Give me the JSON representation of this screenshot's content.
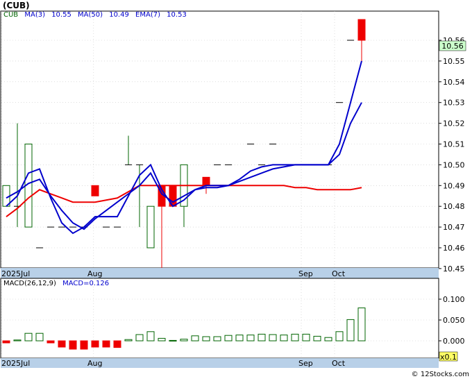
{
  "title": "(CUB)",
  "credit": "© 12Stocks.com",
  "colors": {
    "frame": "#000000",
    "grid": "#c8c8c8",
    "axis_band": "#b8d0e8",
    "ma3": "#0000cc",
    "ma50": "#ee0000",
    "ema7": "#0000cc",
    "up": "#006400",
    "down": "#ee0000",
    "price_badge_bg": "#ccffcc",
    "macd_bar": "#006400",
    "macd_neg": "#ee0000",
    "scale_badge_bg": "#ffff66"
  },
  "price_panel": {
    "legend": {
      "symbol": "CUB",
      "ma3_label": "MA(3)",
      "ma3_value": "10.55",
      "ma50_label": "MA(50)",
      "ma50_value": "10.49",
      "ema7_label": "EMA(7)",
      "ema7_value": "10.53"
    },
    "last_price": "10.56",
    "y_ticks": [
      "10.56",
      "10.55",
      "10.54",
      "10.53",
      "10.52",
      "10.51",
      "10.50",
      "10.49",
      "10.48",
      "10.47",
      "10.46",
      "10.45"
    ],
    "x_labels": [
      "2025Jul",
      "Aug",
      "Sep",
      "Oct"
    ]
  },
  "macd_panel": {
    "legend_label": "MACD(26,12,9)",
    "legend_value_label": "MACD=0.126",
    "y_ticks": [
      "0.100",
      "0.050",
      "0.000"
    ],
    "x_labels": [
      "2025Jul",
      "Aug",
      "Sep",
      "Oct"
    ],
    "scale_badge": "x0.1"
  },
  "chart_data": [
    {
      "type": "candlestick",
      "title": "(CUB)",
      "y_range": [
        10.445,
        10.575
      ],
      "grid": true,
      "candles": [
        {
          "open": 10.48,
          "high": 10.49,
          "low": 10.48,
          "close": 10.49
        },
        {
          "open": 10.48,
          "high": 10.52,
          "low": 10.47,
          "close": 10.48
        },
        {
          "open": 10.47,
          "high": 10.51,
          "low": 10.47,
          "close": 10.51
        },
        {
          "open": 10.46,
          "high": 10.46,
          "low": 10.46,
          "close": 10.46
        },
        {
          "open": 10.47,
          "high": 10.47,
          "low": 10.47,
          "close": 10.47
        },
        {
          "open": 10.47,
          "high": 10.47,
          "low": 10.47,
          "close": 10.47
        },
        {
          "open": 10.47,
          "high": 10.47,
          "low": 10.47,
          "close": 10.47
        },
        {
          "open": 10.47,
          "high": 10.47,
          "low": 10.47,
          "close": 10.47
        },
        {
          "open": 10.49,
          "high": 10.49,
          "low": 10.485,
          "close": 10.485
        },
        {
          "open": 10.47,
          "high": 10.47,
          "low": 10.47,
          "close": 10.47
        },
        {
          "open": 10.47,
          "high": 10.47,
          "low": 10.47,
          "close": 10.47
        },
        {
          "open": 10.5,
          "high": 10.514,
          "low": 10.5,
          "close": 10.5
        },
        {
          "open": 10.5,
          "high": 10.5,
          "low": 10.47,
          "close": 10.5
        },
        {
          "open": 10.46,
          "high": 10.48,
          "low": 10.46,
          "close": 10.48
        },
        {
          "open": 10.49,
          "high": 10.49,
          "low": 10.45,
          "close": 10.48
        },
        {
          "open": 10.49,
          "high": 10.49,
          "low": 10.48,
          "close": 10.48
        },
        {
          "open": 10.48,
          "high": 10.49,
          "low": 10.47,
          "close": 10.5
        },
        {
          "open": 10.49,
          "high": 10.49,
          "low": 10.49,
          "close": 10.49
        },
        {
          "open": 10.494,
          "high": 10.494,
          "low": 10.486,
          "close": 10.49
        },
        {
          "open": 10.5,
          "high": 10.5,
          "low": 10.5,
          "close": 10.5
        },
        {
          "open": 10.5,
          "high": 10.5,
          "low": 10.5,
          "close": 10.5
        },
        {
          "open": 10.49,
          "high": 10.49,
          "low": 10.49,
          "close": 10.49
        },
        {
          "open": 10.51,
          "high": 10.51,
          "low": 10.51,
          "close": 10.51
        },
        {
          "open": 10.5,
          "high": 10.5,
          "low": 10.5,
          "close": 10.5
        },
        {
          "open": 10.51,
          "high": 10.51,
          "low": 10.51,
          "close": 10.51
        },
        {
          "open": 10.5,
          "high": 10.5,
          "low": 10.5,
          "close": 10.5
        },
        {
          "open": 10.5,
          "high": 10.5,
          "low": 10.5,
          "close": 10.5
        },
        {
          "open": 10.5,
          "high": 10.5,
          "low": 10.5,
          "close": 10.5
        },
        {
          "open": 10.5,
          "high": 10.5,
          "low": 10.5,
          "close": 10.5
        },
        {
          "open": 10.5,
          "high": 10.5,
          "low": 10.5,
          "close": 10.5
        },
        {
          "open": 10.53,
          "high": 10.53,
          "low": 10.53,
          "close": 10.53
        },
        {
          "open": 10.56,
          "high": 10.56,
          "low": 10.56,
          "close": 10.56
        },
        {
          "open": 10.57,
          "high": 10.57,
          "low": 10.55,
          "close": 10.56
        }
      ],
      "series": [
        {
          "name": "MA(3)",
          "values": [
            10.48,
            10.485,
            10.496,
            10.498,
            10.484,
            10.472,
            10.467,
            10.47,
            10.475,
            10.475,
            10.475,
            10.485,
            10.495,
            10.5,
            10.488,
            10.48,
            10.483,
            10.488,
            10.49,
            10.49,
            10.49,
            10.493,
            10.497,
            10.499,
            10.5,
            10.5,
            10.5,
            10.5,
            10.5,
            10.5,
            10.51,
            10.53,
            10.55
          ]
        },
        {
          "name": "MA(50)",
          "values": [
            null,
            null,
            null,
            null,
            null,
            null,
            null,
            null,
            null,
            null,
            null,
            null,
            null,
            null,
            null,
            null,
            null,
            null,
            null,
            null,
            null,
            null,
            null,
            null,
            null,
            null,
            null,
            null,
            null,
            null,
            null,
            null,
            null
          ]
        },
        {
          "name": "EMA(7)",
          "values": [
            10.484,
            10.487,
            10.491,
            10.493,
            10.485,
            10.478,
            10.472,
            10.469,
            10.474,
            10.478,
            10.482,
            10.486,
            10.49,
            10.496,
            10.486,
            10.482,
            10.485,
            10.488,
            10.489,
            10.489,
            10.49,
            10.492,
            10.494,
            10.496,
            10.498,
            10.499,
            10.5,
            10.5,
            10.5,
            10.5,
            10.505,
            10.52,
            10.53
          ]
        }
      ]
    },
    {
      "type": "bar",
      "title": "MACD(26,12,9)",
      "y_range": [
        -0.02,
        0.14
      ],
      "grid": true,
      "values": [
        -0.005,
        0.002,
        0.018,
        0.018,
        -0.005,
        -0.015,
        -0.02,
        -0.02,
        -0.015,
        -0.015,
        -0.016,
        0.003,
        0.015,
        0.022,
        0.006,
        0.001,
        0.004,
        0.012,
        0.01,
        0.01,
        0.013,
        0.014,
        0.014,
        0.016,
        0.015,
        0.014,
        0.016,
        0.016,
        0.011,
        0.008,
        0.022,
        0.051,
        0.079
      ]
    }
  ]
}
